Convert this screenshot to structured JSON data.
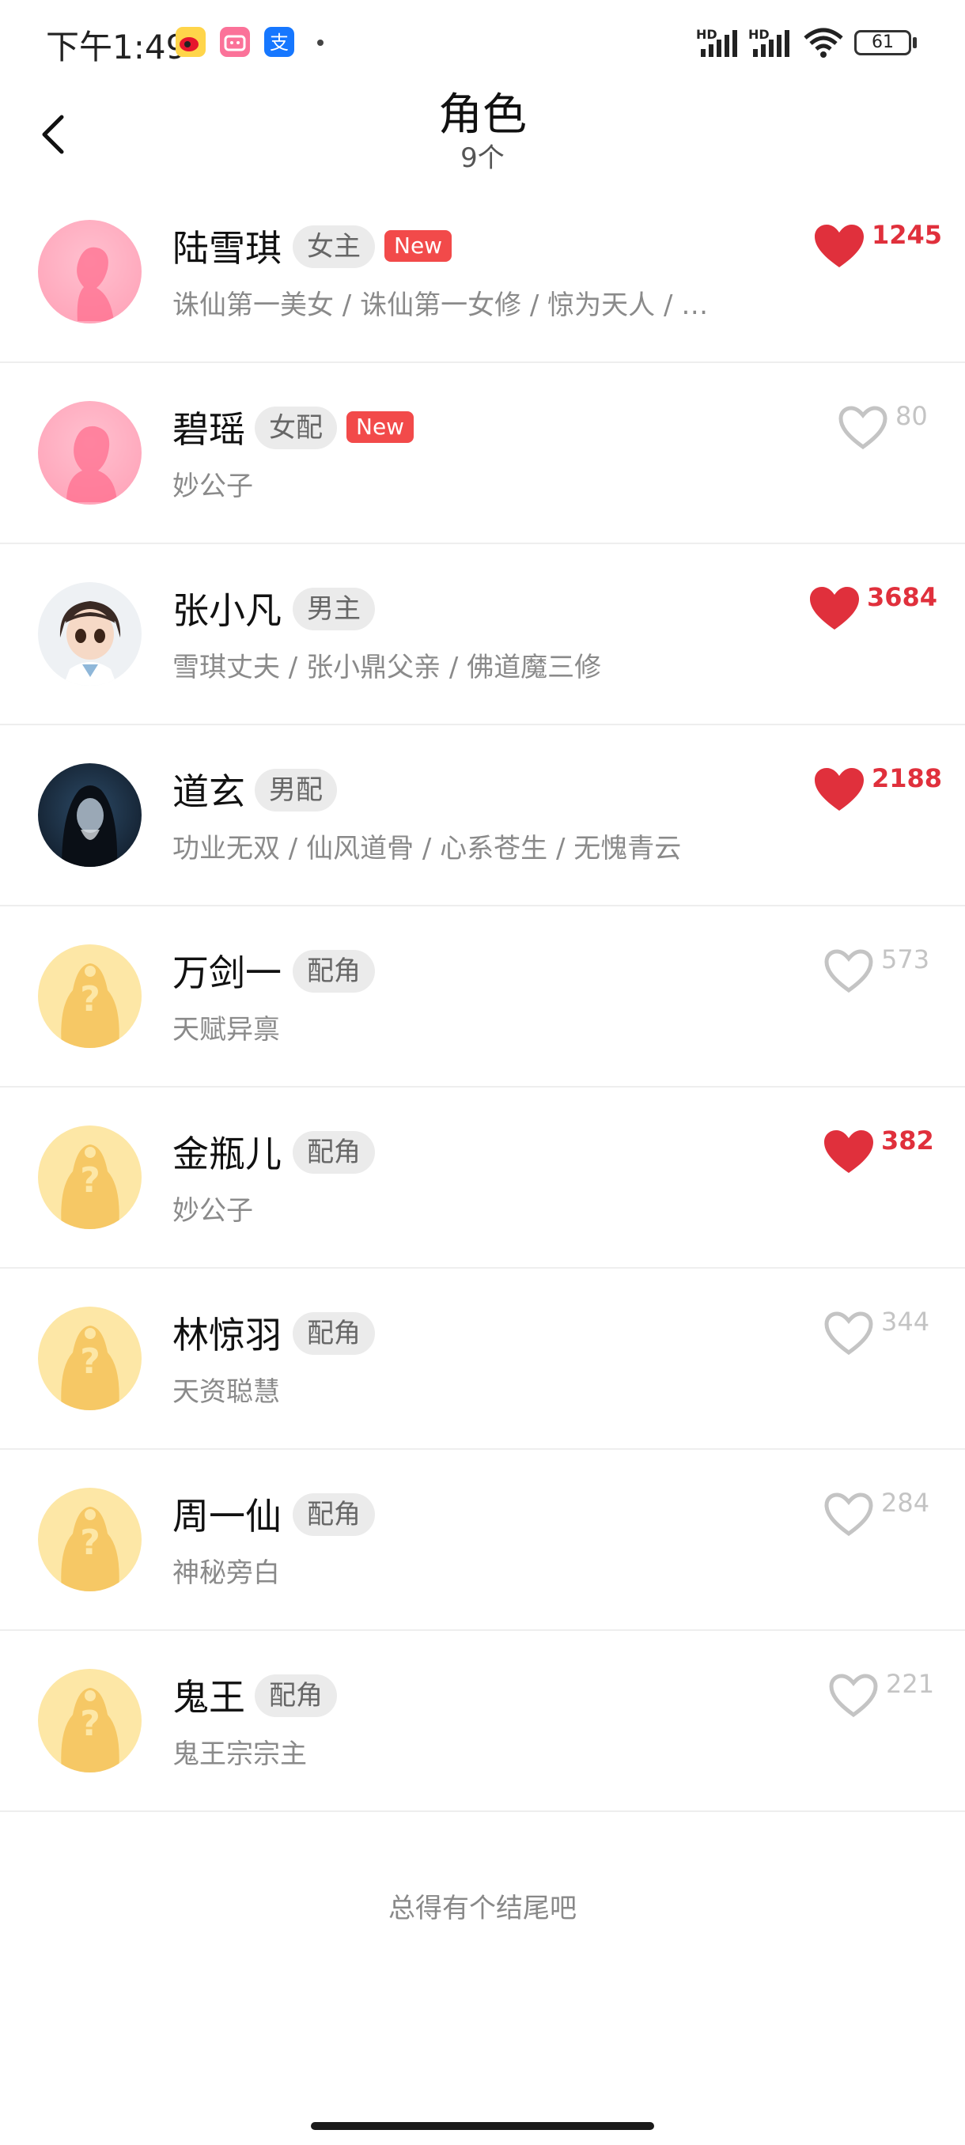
{
  "status_bar": {
    "time": "下午1:49",
    "network_label_1": "HD",
    "network_label_2": "HD",
    "battery": "61",
    "app_icons": [
      "weibo-icon",
      "bilibili-icon",
      "alipay-icon"
    ]
  },
  "header": {
    "title": "角色",
    "count": "9个"
  },
  "characters": [
    {
      "name": "陆雪琪",
      "role": "女主",
      "is_new": true,
      "new_label": "New",
      "desc": "诛仙第一美女 / 诛仙第一女修 / 惊为天人 / …",
      "likes": "1245",
      "liked": true,
      "avatar": "pink-female-silhouette"
    },
    {
      "name": "碧瑶",
      "role": "女配",
      "is_new": true,
      "new_label": "New",
      "desc": "妙公子",
      "likes": "80",
      "liked": false,
      "avatar": "pink-female-silhouette"
    },
    {
      "name": "张小凡",
      "role": "男主",
      "is_new": false,
      "desc": "雪琪丈夫 / 张小鼎父亲 / 佛道魔三修",
      "likes": "3684",
      "liked": true,
      "avatar": "cartoon-male-portrait"
    },
    {
      "name": "道玄",
      "role": "男配",
      "is_new": false,
      "desc": "功业无双 / 仙风道骨 / 心系苍生 / 无愧青云",
      "likes": "2188",
      "liked": true,
      "avatar": "dark-male-portrait"
    },
    {
      "name": "万剑一",
      "role": "配角",
      "is_new": false,
      "desc": "天赋异禀",
      "likes": "573",
      "liked": false,
      "avatar": "placeholder-question"
    },
    {
      "name": "金瓶儿",
      "role": "配角",
      "is_new": false,
      "desc": "妙公子",
      "likes": "382",
      "liked": true,
      "avatar": "placeholder-question"
    },
    {
      "name": "林惊羽",
      "role": "配角",
      "is_new": false,
      "desc": "天资聪慧",
      "likes": "344",
      "liked": false,
      "avatar": "placeholder-question"
    },
    {
      "name": "周一仙",
      "role": "配角",
      "is_new": false,
      "desc": "神秘旁白",
      "likes": "284",
      "liked": false,
      "avatar": "placeholder-question"
    },
    {
      "name": "鬼王",
      "role": "配角",
      "is_new": false,
      "desc": "鬼王宗宗主",
      "likes": "221",
      "liked": false,
      "avatar": "placeholder-question"
    }
  ],
  "footer": {
    "text": "总得有个结尾吧"
  },
  "colors": {
    "liked": "#e0303c",
    "unliked": "#c4c4c4",
    "new_badge": "#f24a4a",
    "tag_bg": "#ebebeb"
  }
}
